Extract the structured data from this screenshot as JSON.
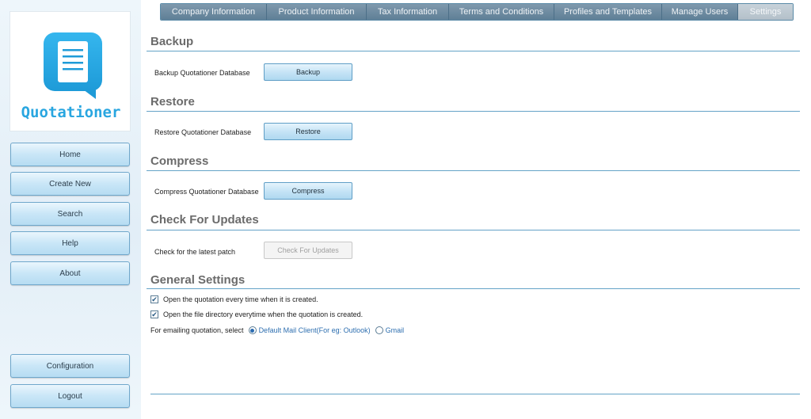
{
  "app": {
    "logo_text": "Quotationer"
  },
  "sidebar": {
    "nav": [
      {
        "label": "Home"
      },
      {
        "label": "Create New"
      },
      {
        "label": "Search"
      },
      {
        "label": "Help"
      },
      {
        "label": "About"
      }
    ],
    "configuration_label": "Configuration",
    "logout_label": "Logout"
  },
  "tabs": [
    {
      "label": "Company Information",
      "active": false
    },
    {
      "label": "Product Information",
      "active": false
    },
    {
      "label": "Tax Information",
      "active": false
    },
    {
      "label": "Terms and Conditions",
      "active": false
    },
    {
      "label": "Profiles and Templates",
      "active": false
    },
    {
      "label": "Manage Users",
      "active": false
    },
    {
      "label": "Settings",
      "active": true
    }
  ],
  "settings": {
    "backup": {
      "title": "Backup",
      "label": "Backup Quotationer Database",
      "button": "Backup"
    },
    "restore": {
      "title": "Restore",
      "label": "Restore Quotationer Database",
      "button": "Restore"
    },
    "compress": {
      "title": "Compress",
      "label": "Compress Quotationer Database",
      "button": "Compress"
    },
    "updates": {
      "title": "Check For Updates",
      "label": "Check for the latest patch",
      "button": "Check For Updates",
      "button_enabled": false
    },
    "general": {
      "title": "General Settings",
      "open_quotation": {
        "label": "Open the quotation every time when it is created.",
        "checked": true
      },
      "open_directory": {
        "label": "Open the file directory everytime when the quotation is created.",
        "checked": true
      },
      "email_label": "For emailing quotation, select",
      "email_options": [
        {
          "label": "Default Mail Client(For eg: Outlook)",
          "selected": true
        },
        {
          "label": "Gmail",
          "selected": false
        }
      ]
    }
  },
  "colors": {
    "accent": "#29a6e0",
    "tab_bg": "#6a889d",
    "tab_active_bg": "#bcc7cf",
    "section_line": "#64a3c7"
  }
}
